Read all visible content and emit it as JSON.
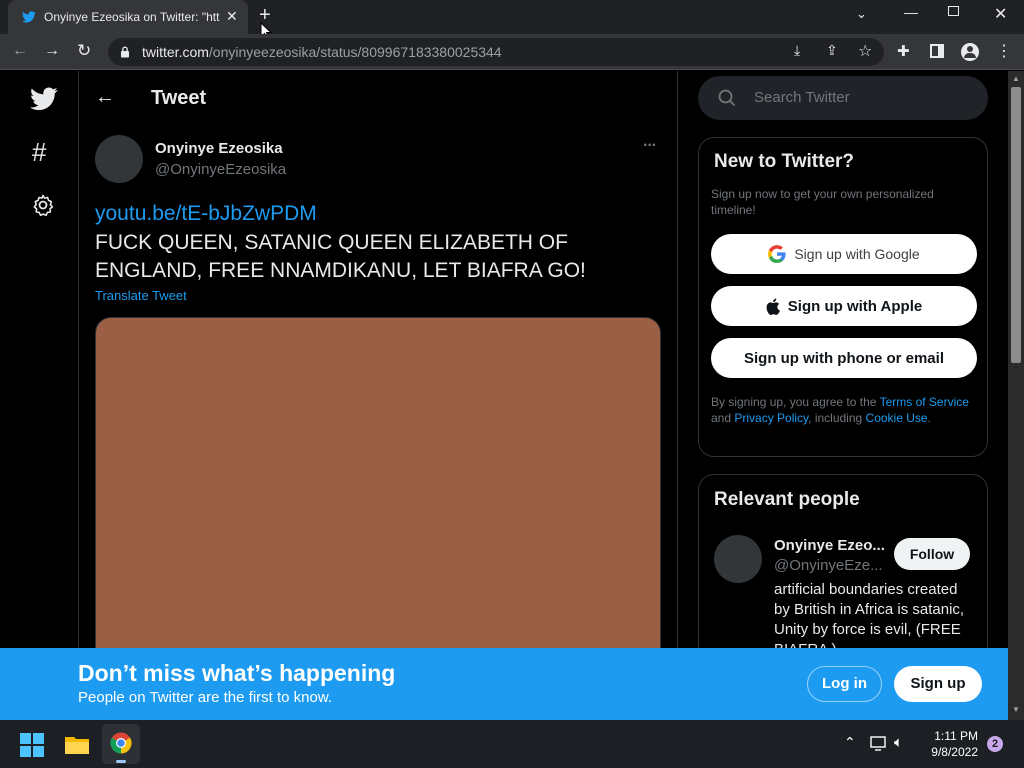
{
  "browser": {
    "tab_title": "Onyinye Ezeosika on Twitter: \"htt",
    "url_host": "twitter.com",
    "url_path": "/onyinyeezeosika/status/809967183380025344"
  },
  "nav": {
    "header_title": "Tweet"
  },
  "tweet": {
    "author_name": "Onyinye Ezeosika",
    "author_handle": "@OnyinyeEzeosika",
    "link": "youtu.be/tE-bJbZwPDM",
    "text": "FUCK QUEEN, SATANIC QUEEN ELIZABETH OF ENGLAND, FREE NNAMDIKANU, LET BIAFRA GO!",
    "translate_label": "Translate Tweet",
    "more_label": "···",
    "media_color": "#9b5f45"
  },
  "search": {
    "placeholder": "Search Twitter"
  },
  "signup_card": {
    "title": "New to Twitter?",
    "subtitle": "Sign up now to get your own personalized timeline!",
    "google_label": "Sign up with Google",
    "apple_label": "Sign up with Apple",
    "phone_label": "Sign up with phone or email",
    "legal_prefix": "By signing up, you agree to the ",
    "terms_link": "Terms of Service",
    "legal_and": " and ",
    "privacy_link": "Privacy Policy",
    "legal_including": ", including ",
    "cookie_link": "Cookie Use",
    "legal_end": "."
  },
  "relevant_people": {
    "title": "Relevant people",
    "name": "Onyinye Ezeo...",
    "handle": "@OnyinyeEze...",
    "follow_label": "Follow",
    "bio": "artificial boundaries created by British in Africa is satanic, Unity by force is evil, (FREE BIAFRA )"
  },
  "banner": {
    "title": "Don’t miss what’s happening",
    "subtitle": "People on Twitter are the first to know.",
    "login_label": "Log in",
    "signup_label": "Sign up"
  },
  "taskbar": {
    "time": "1:11 PM",
    "date": "9/8/2022",
    "notification_count": "2"
  },
  "colors": {
    "twitter_blue": "#1d9bf0",
    "background": "#000000"
  }
}
